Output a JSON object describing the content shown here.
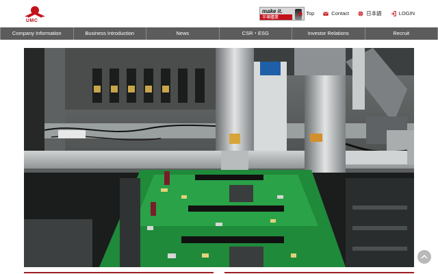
{
  "brand": {
    "logo_text": "UMC"
  },
  "banner": {
    "title": "make it.",
    "subtitle": "半導體業"
  },
  "top_links": [
    {
      "label": "Top",
      "icon": "home-icon"
    },
    {
      "label": "Contact",
      "icon": "mail-icon"
    },
    {
      "label": "日本語",
      "icon": "globe-icon"
    },
    {
      "label": "LOGIN",
      "icon": "login-icon"
    }
  ],
  "nav": [
    {
      "label": "Company Information"
    },
    {
      "label": "Business Introduction"
    },
    {
      "label": "News"
    },
    {
      "label": "CSR・ESG"
    },
    {
      "label": "Investor Relations"
    },
    {
      "label": "Recruit"
    }
  ],
  "colors": {
    "brand_red": "#c4121b",
    "nav_bg": "#5c5c5c",
    "board_green": "#1f8a3a"
  }
}
